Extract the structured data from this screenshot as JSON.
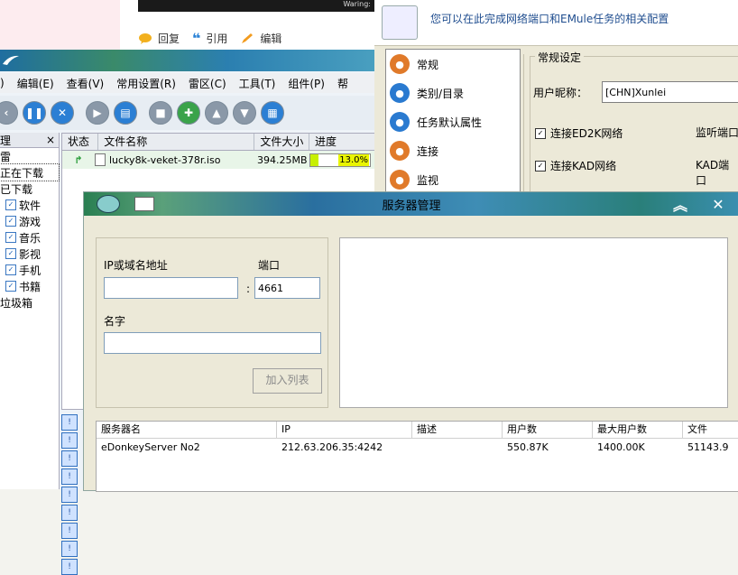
{
  "web": {
    "darkbar_text": "Waring:",
    "actions": [
      {
        "label": "回复",
        "icon": "reply-bubble-icon"
      },
      {
        "label": "引用",
        "icon": "quote-icon"
      },
      {
        "label": "编辑",
        "icon": "pencil-icon"
      }
    ]
  },
  "thunder": {
    "menu": [
      "编辑(E)",
      "查看(V)",
      "常用设置(R)",
      "雷区(C)",
      "工具(T)",
      "组件(P)",
      "帮"
    ],
    "menu_partial_first": ")",
    "tree_header": "理",
    "tree_header_close": "×",
    "tree_items": [
      {
        "label": "雷",
        "checkbox": false,
        "indent": 0
      },
      {
        "label": "正在下载",
        "checkbox": false,
        "indent": 0,
        "selected": true
      },
      {
        "label": "已下载",
        "checkbox": false,
        "indent": 0
      },
      {
        "label": "软件",
        "checkbox": true,
        "indent": 1
      },
      {
        "label": "游戏",
        "checkbox": true,
        "indent": 1
      },
      {
        "label": "音乐",
        "checkbox": true,
        "indent": 1
      },
      {
        "label": "影视",
        "checkbox": true,
        "indent": 1
      },
      {
        "label": "手机",
        "checkbox": true,
        "indent": 1
      },
      {
        "label": "书籍",
        "checkbox": true,
        "indent": 1
      },
      {
        "label": "垃圾箱",
        "checkbox": false,
        "indent": 0
      }
    ],
    "columns": [
      "状态",
      "文件名称",
      "文件大小",
      "进度"
    ],
    "task": {
      "name": "lucky8k-veket-378r.iso",
      "size": "394.25MB",
      "progress_text": "13.0%",
      "progress": 0.13
    },
    "log_mark": "!",
    "log_count": 9
  },
  "options": {
    "header_text": "您可以在此完成网络端口和EMule任务的相关配置",
    "categories": [
      {
        "label": "常规",
        "color": "#e07a2a",
        "icon": "user-icon"
      },
      {
        "label": "类别/目录",
        "color": "#2a7ad0",
        "icon": "folder-icon"
      },
      {
        "label": "任务默认属性",
        "color": "#2a7ad0",
        "icon": "star-icon"
      },
      {
        "label": "连接",
        "color": "#e07a2a",
        "icon": "connect-icon"
      },
      {
        "label": "监视",
        "color": "#e07a2a",
        "icon": "monitor-icon"
      }
    ],
    "section_title": "常规设定",
    "nickname_label": "用户昵称：",
    "nickname_value": "[CHN]Xunlei",
    "ed2k_label": "连接ED2K网络",
    "kad_label": "连接KAD网络",
    "listen_port_label": "监听端口",
    "kad_port_label": "KAD端口"
  },
  "server_dialog": {
    "title": "服务器管理",
    "ip_label": "IP或域名地址",
    "port_label": "端口",
    "colon": ":",
    "port_value": "4661",
    "name_label": "名字",
    "add_button": "加入列表",
    "table_headers": [
      "服务器名",
      "IP",
      "描述",
      "用户数",
      "最大用户数",
      "文件"
    ],
    "rows": [
      {
        "name": "eDonkeyServer No2",
        "ip": "212.63.206.35:4242",
        "desc": "",
        "users": "550.87K",
        "max_users": "1400.00K",
        "files": "51143.9"
      }
    ]
  }
}
